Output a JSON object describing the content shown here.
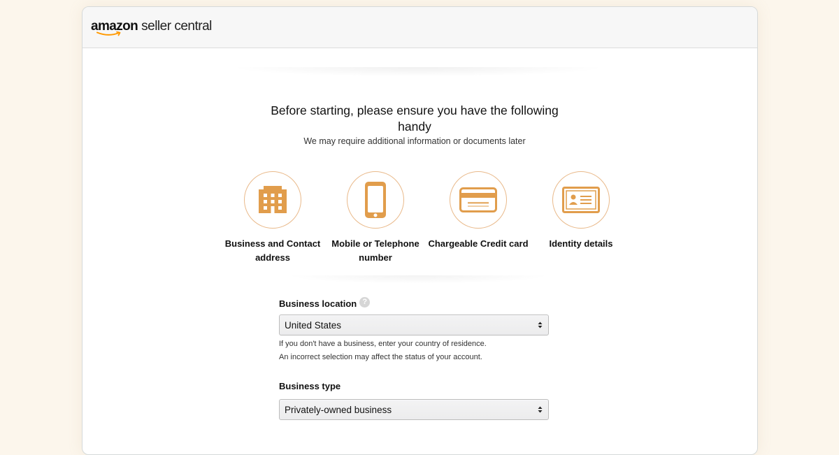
{
  "brand": {
    "name": "amazon",
    "suffix": "seller central",
    "accent_color": "#ff9900"
  },
  "intro": {
    "title": "Before starting, please ensure you have the following handy",
    "subtitle": "We may require additional information or documents later"
  },
  "requirements": [
    {
      "icon": "building-icon",
      "label": "Business and Contact address"
    },
    {
      "icon": "mobile-phone-icon",
      "label": "Mobile or Telephone number"
    },
    {
      "icon": "credit-card-icon",
      "label": "Chargeable Credit card"
    },
    {
      "icon": "id-card-icon",
      "label": "Identity details"
    }
  ],
  "icon_color": "#e19d4c",
  "form": {
    "business_location": {
      "label": "Business location",
      "help_icon": "?",
      "value": "United States",
      "hint_1": "If you don't have a business, enter your country of residence.",
      "hint_2": "An incorrect selection may affect the status of your account."
    },
    "business_type": {
      "label": "Business type",
      "value": "Privately-owned business"
    }
  }
}
